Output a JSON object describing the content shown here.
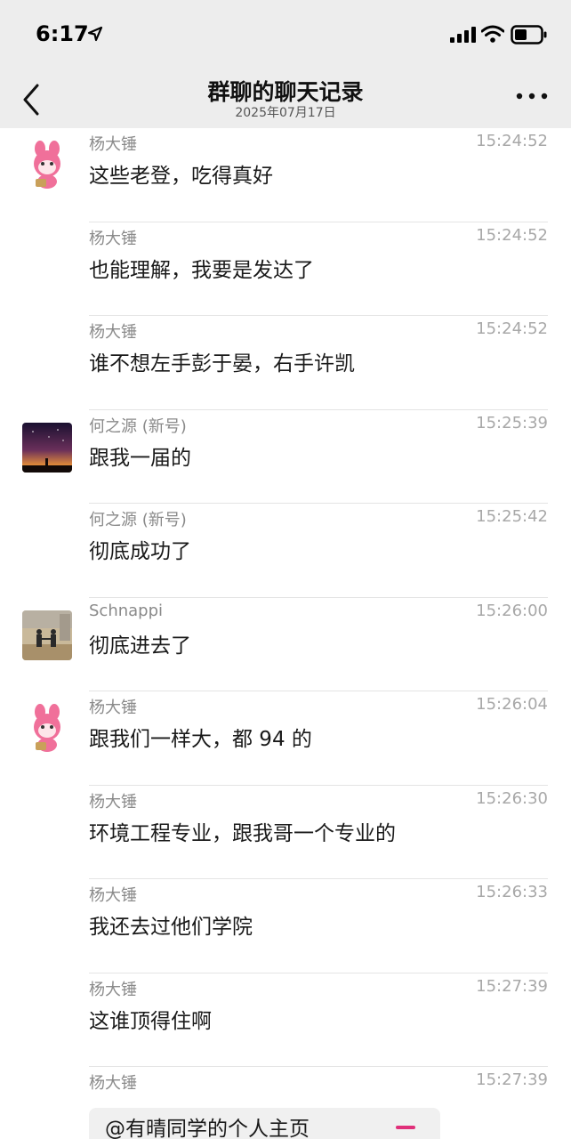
{
  "status_bar": {
    "time": "6:17",
    "icons": [
      "location-arrow-icon",
      "cellular-signal-icon",
      "wifi-icon",
      "battery-icon"
    ]
  },
  "nav": {
    "title": "群聊的聊天记录",
    "date": "2025年07月17日",
    "back_icon": "chevron-left-icon",
    "more_icon": "more-dots-icon"
  },
  "messages": [
    {
      "sender": "杨大锤",
      "time": "15:24:52",
      "text": "这些老登，吃得真好",
      "avatar": "pink-bunny"
    },
    {
      "sender": "杨大锤",
      "time": "15:24:52",
      "text": "也能理解，我要是发达了"
    },
    {
      "sender": "杨大锤",
      "time": "15:24:52",
      "text": "谁不想左手彭于晏，右手许凯"
    },
    {
      "sender": "何之源 (新号)",
      "time": "15:25:39",
      "text": "跟我一届的",
      "avatar": "night-sky"
    },
    {
      "sender": "何之源 (新号)",
      "time": "15:25:42",
      "text": "彻底成功了"
    },
    {
      "sender": "Schnappi",
      "time": "15:26:00",
      "text": "彻底进去了",
      "avatar": "handshake-photo"
    },
    {
      "sender": "杨大锤",
      "time": "15:26:04",
      "text": "跟我们一样大，都 94 的",
      "avatar": "pink-bunny"
    },
    {
      "sender": "杨大锤",
      "time": "15:26:30",
      "text": "环境工程专业，跟我哥一个专业的"
    },
    {
      "sender": "杨大锤",
      "time": "15:26:33",
      "text": "我还去过他们学院"
    },
    {
      "sender": "杨大锤",
      "time": "15:27:39",
      "text": "这谁顶得住啊"
    },
    {
      "sender": "杨大锤",
      "time": "15:27:39",
      "quote": "@有晴同学的个人主页"
    }
  ],
  "colors": {
    "header_bg": "#ededed",
    "sender_gray": "#8a8a8a",
    "time_gray": "#a8a8a8",
    "bunny_pink": "#f0709a",
    "link_accent": "#e0307a"
  }
}
